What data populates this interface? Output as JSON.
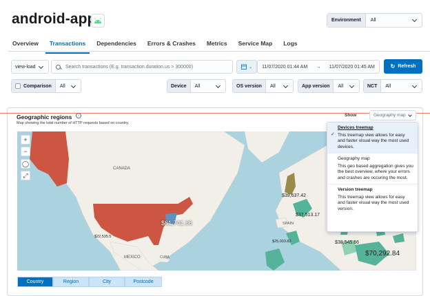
{
  "header": {
    "title": "android-app",
    "environment_label": "Environment",
    "environment_value": "All"
  },
  "tabs": [
    "Overview",
    "Transactions",
    "Dependencies",
    "Errors & Crashes",
    "Metrics",
    "Service Map",
    "Logs"
  ],
  "active_tab": "Transactions",
  "search": {
    "type_value": "view-load",
    "placeholder": "Search transactions (E.g. transaction.duration.us > 300000)",
    "date_start": "11/07/2020 01:44 AM",
    "date_arrow": "→",
    "date_end": "11/07/2020 01:45 AM",
    "refresh_label": "Refresh"
  },
  "filters": {
    "comparison_label": "Comparison",
    "comparison_value": "All",
    "device_label": "Device",
    "device_value": "All",
    "os_label": "OS version",
    "os_value": "All",
    "app_label": "App version",
    "app_value": "All",
    "nct_label": "NCT",
    "nct_value": "All"
  },
  "geo": {
    "title": "Geographic regions",
    "subtitle": "Map showing the total number of HTTP requests based on country.",
    "show_label": "Show",
    "show_value": "Geography map"
  },
  "map_labels": {
    "canada": "CANADA",
    "mexico": "MEXICO",
    "cuba": "CUBA",
    "spain": "SPAIN",
    "val_us": "$61,741.66",
    "val_us_small": "$22,535.5",
    "val_uk": "$39,637.42",
    "val_eu": "$37,513.17",
    "val_africa": "$25,003.82",
    "val_me": "$38,545.66",
    "val_saudi": "$70,292.84"
  },
  "dropdown": [
    {
      "title": "Devices treemap",
      "desc": "This treemap view allows for easy and faster visual way the most used devices."
    },
    {
      "title": "Geography map",
      "desc": "This geo based aggregation gives you the best overview, where your errors and crashes are occuring the most."
    },
    {
      "title": "Version treemap",
      "desc": "This treemap view allows for easy and faster visual way the most used version."
    }
  ],
  "bottom_tabs": [
    "Country",
    "Region",
    "City",
    "Postcode"
  ],
  "colors": {
    "primary": "#0071c2",
    "choropleth_high": "#cc5642",
    "choropleth_mid": "#54b399",
    "choropleth_low": "#9b8b4b"
  }
}
